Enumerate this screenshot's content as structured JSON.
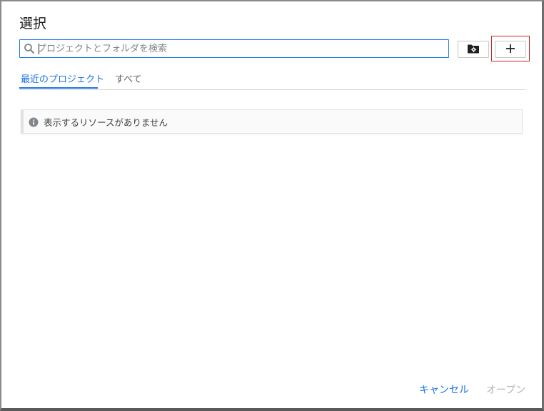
{
  "dialog": {
    "title": "選択"
  },
  "search": {
    "placeholder": "プロジェクトとフォルダを検索",
    "value": ""
  },
  "toolbar": {
    "folder_icon": "folder-settings-icon",
    "add_icon": "plus-icon"
  },
  "tabs": [
    {
      "label": "最近のプロジェクト",
      "active": true
    },
    {
      "label": "すべて",
      "active": false
    }
  ],
  "notice": {
    "icon": "info-icon",
    "text": "表示するリソースがありません"
  },
  "footer": {
    "cancel_label": "キャンセル",
    "open_label": "オープン"
  },
  "colors": {
    "accent": "#1a73e8",
    "highlight": "#c62828",
    "disabled": "#b0b4b8"
  }
}
